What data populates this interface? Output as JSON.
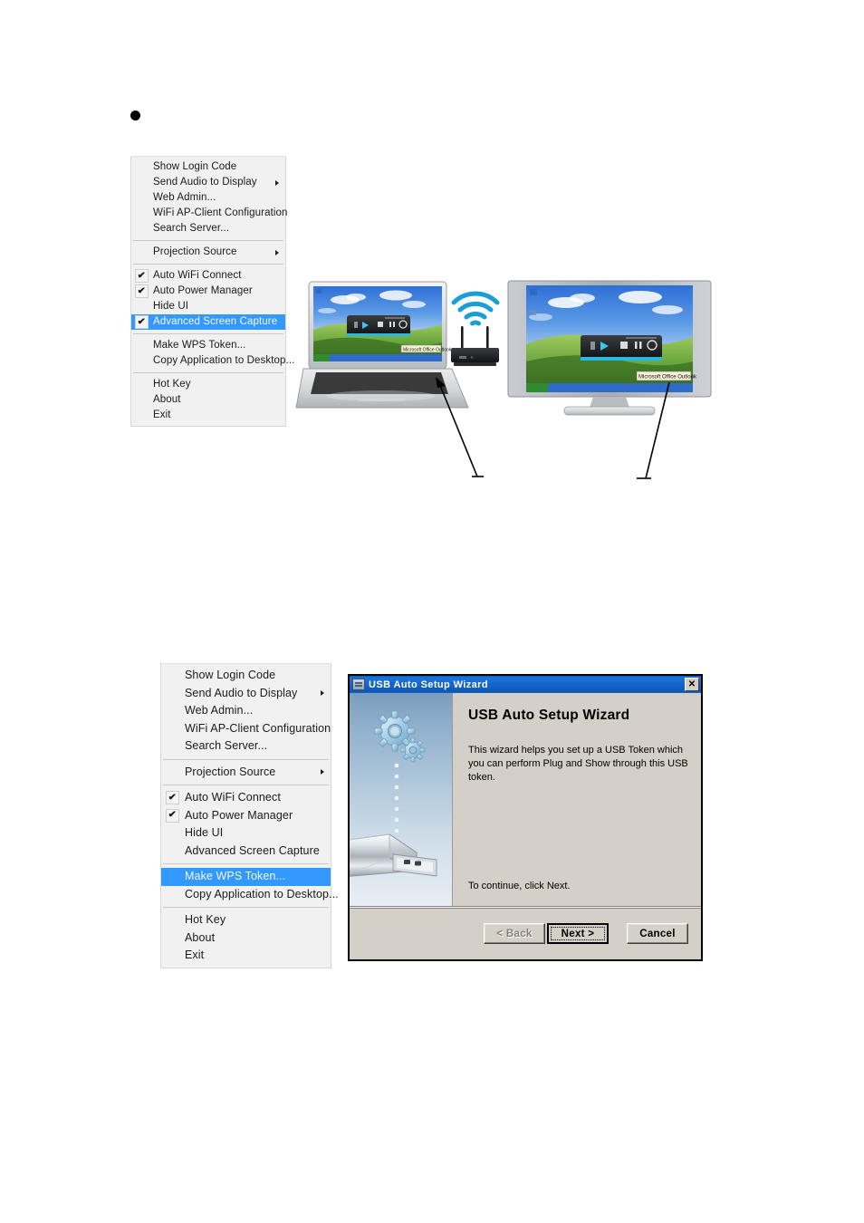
{
  "page": {
    "bullet": "•"
  },
  "context_menu_1": {
    "name": "Projection utility tray menu",
    "selected_item": "Advanced Screen Capture",
    "groups": [
      {
        "items": [
          {
            "label": "Show Login Code",
            "checked": false,
            "submenu": false,
            "selected": false
          },
          {
            "label": "Send Audio to Display",
            "checked": false,
            "submenu": true,
            "selected": false
          },
          {
            "label": "Web Admin...",
            "checked": false,
            "submenu": false,
            "selected": false
          },
          {
            "label": "WiFi AP-Client Configuration",
            "checked": false,
            "submenu": false,
            "selected": false
          },
          {
            "label": "Search Server...",
            "checked": false,
            "submenu": false,
            "selected": false
          }
        ]
      },
      {
        "items": [
          {
            "label": "Projection Source",
            "checked": false,
            "submenu": true,
            "selected": false
          }
        ]
      },
      {
        "items": [
          {
            "label": "Auto WiFi Connect",
            "checked": true,
            "submenu": false,
            "selected": false
          },
          {
            "label": "Auto Power Manager",
            "checked": true,
            "submenu": false,
            "selected": false
          },
          {
            "label": "Hide UI",
            "checked": false,
            "submenu": false,
            "selected": false
          },
          {
            "label": "Advanced Screen Capture",
            "checked": true,
            "submenu": false,
            "selected": true
          }
        ]
      },
      {
        "items": [
          {
            "label": "Make WPS Token...",
            "checked": false,
            "submenu": false,
            "selected": false
          },
          {
            "label": "Copy Application to Desktop...",
            "checked": false,
            "submenu": false,
            "selected": false
          }
        ]
      },
      {
        "items": [
          {
            "label": "Hot Key",
            "checked": false,
            "submenu": false,
            "selected": false
          },
          {
            "label": "About",
            "checked": false,
            "submenu": false,
            "selected": false
          },
          {
            "label": "Exit",
            "checked": false,
            "submenu": false,
            "selected": false
          }
        ]
      }
    ]
  },
  "context_menu_2": {
    "name": "Projection utility tray menu",
    "selected_item": "Make WPS Token...",
    "groups": [
      {
        "items": [
          {
            "label": "Show Login Code",
            "checked": false,
            "submenu": false,
            "selected": false
          },
          {
            "label": "Send Audio to Display",
            "checked": false,
            "submenu": true,
            "selected": false
          },
          {
            "label": "Web Admin...",
            "checked": false,
            "submenu": false,
            "selected": false
          },
          {
            "label": "WiFi AP-Client Configuration",
            "checked": false,
            "submenu": false,
            "selected": false
          },
          {
            "label": "Search Server...",
            "checked": false,
            "submenu": false,
            "selected": false
          }
        ]
      },
      {
        "items": [
          {
            "label": "Projection Source",
            "checked": false,
            "submenu": true,
            "selected": false
          }
        ]
      },
      {
        "items": [
          {
            "label": "Auto WiFi Connect",
            "checked": true,
            "submenu": false,
            "selected": false
          },
          {
            "label": "Auto Power Manager",
            "checked": true,
            "submenu": false,
            "selected": false
          },
          {
            "label": "Hide UI",
            "checked": false,
            "submenu": false,
            "selected": false
          },
          {
            "label": "Advanced Screen Capture",
            "checked": false,
            "submenu": false,
            "selected": false
          }
        ]
      },
      {
        "items": [
          {
            "label": "Make WPS Token...",
            "checked": false,
            "submenu": false,
            "selected": true
          },
          {
            "label": "Copy Application to Desktop...",
            "checked": false,
            "submenu": false,
            "selected": false
          }
        ]
      },
      {
        "items": [
          {
            "label": "Hot Key",
            "checked": false,
            "submenu": false,
            "selected": false
          },
          {
            "label": "About",
            "checked": false,
            "submenu": false,
            "selected": false
          },
          {
            "label": "Exit",
            "checked": false,
            "submenu": false,
            "selected": false
          }
        ]
      }
    ]
  },
  "illustration": {
    "name": "wireless-projection-diagram",
    "laptop_taskbar_label": "Microsoft Office Outlook",
    "tv_taskbar_label": "Microsoft Office Outlook",
    "wifi_symbol": "wifi-waves-icon",
    "devices": [
      "laptop",
      "wireless-projection-box",
      "television"
    ]
  },
  "wizard": {
    "title": "USB Auto Setup Wizard",
    "close_label": "✕",
    "heading": "USB Auto Setup Wizard",
    "paragraph": "This wizard helps you set up a USB Token which you can perform Plug and Show through this USB token.",
    "continue_text": "To continue, click Next.",
    "buttons": {
      "back": "< Back",
      "next": "Next >",
      "cancel": "Cancel"
    },
    "colors": {
      "titlebar": "#1567cd",
      "dialog_face": "#d4d0c8",
      "panel_top": "#7a9ec0",
      "panel_bottom": "#e8eef4"
    }
  }
}
